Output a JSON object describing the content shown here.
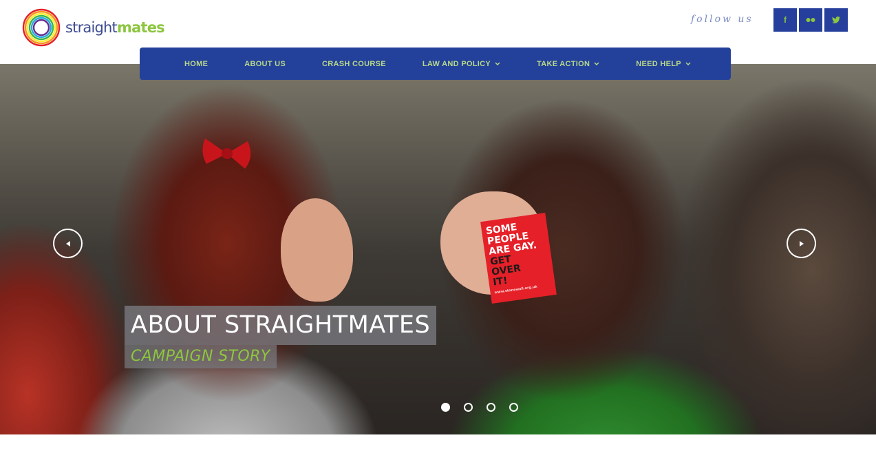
{
  "header": {
    "logo_text_light": "straight",
    "logo_text_bold": "mates",
    "follow_label": "follow us",
    "social": [
      {
        "name": "facebook",
        "glyph": "f",
        "icon": "facebook-icon"
      },
      {
        "name": "flickr",
        "glyph": "●●",
        "icon": "flickr-icon"
      },
      {
        "name": "twitter",
        "glyph": "🐦",
        "icon": "twitter-icon"
      }
    ]
  },
  "nav": {
    "items": [
      {
        "label": "HOME",
        "dropdown": false
      },
      {
        "label": "ABOUT US",
        "dropdown": false
      },
      {
        "label": "CRASH COURSE",
        "dropdown": false
      },
      {
        "label": "LAW AND POLICY",
        "dropdown": true
      },
      {
        "label": "TAKE ACTION",
        "dropdown": true
      },
      {
        "label": "NEED HELP",
        "dropdown": true
      }
    ]
  },
  "hero": {
    "sticker_lines": [
      "SOME",
      "PEOPLE",
      "ARE GAY.",
      "GET",
      "OVER",
      "IT!"
    ],
    "sticker_url": "www.stonewall.org.uk",
    "title": "ABOUT STRAIGHTMATES",
    "subtitle": "CAMPAIGN STORY",
    "slides": 4,
    "active_slide": 1
  },
  "colors": {
    "brand_blue": "#23409a",
    "brand_green": "#8dc63f",
    "nav_text": "#b8d98a"
  }
}
